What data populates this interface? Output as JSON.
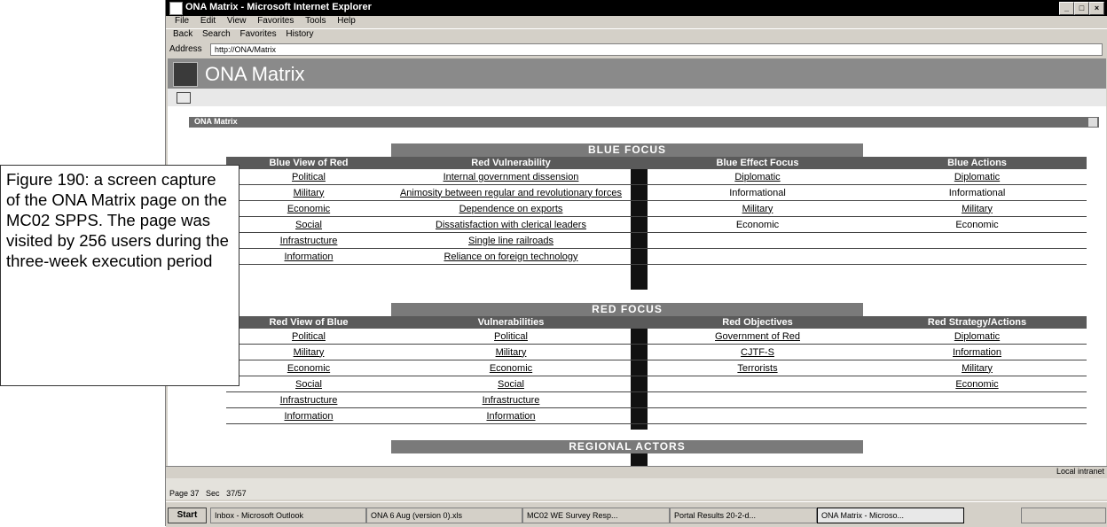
{
  "window": {
    "title": "ONA Matrix - Microsoft Internet Explorer",
    "menu": [
      "File",
      "Edit",
      "View",
      "Favorites",
      "Tools",
      "Help"
    ],
    "toolbar": [
      "Back",
      "Search",
      "Favorites",
      "History"
    ],
    "address_label": "Address",
    "address_value": "http://ONA/Matrix"
  },
  "page": {
    "title": "ONA Matrix",
    "portlet_title": "ONA Matrix"
  },
  "blue_focus": {
    "title": "BLUE FOCUS",
    "headers": [
      "Blue View of Red",
      "Red Vulnerability",
      "Blue Effect Focus",
      "Blue Actions"
    ],
    "rows": [
      [
        "Political",
        "Internal government dissension",
        "Diplomatic",
        "Diplomatic"
      ],
      [
        "Military",
        "Animosity between regular and revolutionary forces",
        "Informational",
        "Informational"
      ],
      [
        "Economic",
        "Dependence on exports",
        "Military",
        "Military"
      ],
      [
        "Social",
        "Dissatisfaction with clerical leaders",
        "Economic",
        "Economic"
      ],
      [
        "Infrastructure",
        "Single line railroads",
        "",
        ""
      ],
      [
        "Information",
        "Reliance on foreign technology",
        "",
        ""
      ]
    ]
  },
  "red_focus": {
    "title": "RED FOCUS",
    "headers": [
      "Red View of Blue",
      "Vulnerabilities",
      "Red Objectives",
      "Red Strategy/Actions"
    ],
    "rows": [
      [
        "Political",
        "Political",
        "Government of Red",
        "Diplomatic"
      ],
      [
        "Military",
        "Military",
        "CJTF-S",
        "Information"
      ],
      [
        "Economic",
        "Economic",
        "Terrorists",
        "Military"
      ],
      [
        "Social",
        "Social",
        "",
        "Economic"
      ],
      [
        "Infrastructure",
        "Infrastructure",
        "",
        ""
      ],
      [
        "Information",
        "Information",
        "",
        ""
      ]
    ]
  },
  "regional_actors": {
    "title": "REGIONAL ACTORS"
  },
  "status": {
    "zone": "Local intranet"
  },
  "word": {
    "page": "Page 37",
    "sec": "Sec",
    "pos": "37/57"
  },
  "taskbar": {
    "start": "Start",
    "items": [
      "Inbox - Microsoft Outlook",
      "ONA 6 Aug (version 0).xls",
      "MC02 WE Survey Resp...",
      "Portal Results 20-2-d...",
      "ONA Matrix - Microso..."
    ]
  },
  "caption": "Figure 190: a screen capture of the ONA Matrix page on the MC02 SPPS. The page was visited by 256 users during the three-week execution period"
}
